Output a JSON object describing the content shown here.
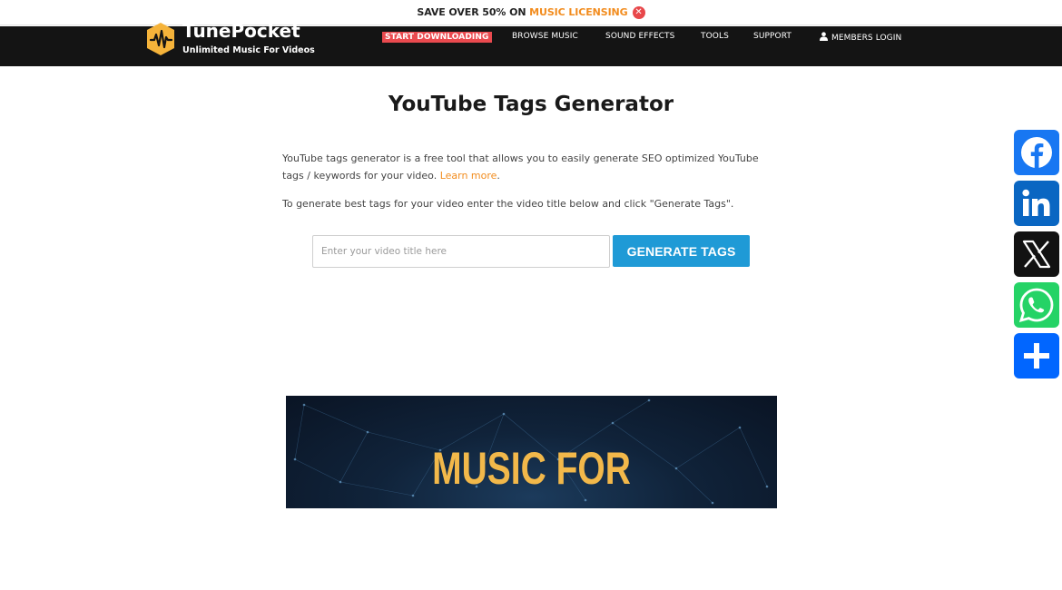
{
  "promo": {
    "prefix": "SAVE OVER 50% ON ",
    "link": "MUSIC LICENSING",
    "close_icon": "close-icon"
  },
  "header": {
    "logo_name": "TunePocket",
    "logo_tagline": "Unlimited Music For Videos",
    "nav": {
      "start": "START DOWNLOADING",
      "browse": "BROWSE MUSIC",
      "sfx": "SOUND EFFECTS",
      "tools": "TOOLS",
      "support": "SUPPORT",
      "login": "MEMBERS LOGIN"
    },
    "colors": {
      "bar": "#141414",
      "start_badge": "#ea4a4f",
      "logo": "#f5b33a"
    }
  },
  "main": {
    "title": "YouTube Tags Generator",
    "intro": "YouTube tags generator is a free tool that allows you to easily generate SEO optimized YouTube tags / keywords for your video. ",
    "learn_more": "Learn more",
    "intro_end": ".",
    "instruction": "To generate best tags for your video enter the video title below and click \"Generate Tags\".",
    "input_placeholder": "Enter your video title here",
    "input_value": "",
    "button": "GENERATE TAGS"
  },
  "banner": {
    "text": "MUSIC FOR"
  },
  "share": {
    "items": [
      {
        "name": "Facebook",
        "icon": "facebook-icon",
        "color": "#1877f2"
      },
      {
        "name": "LinkedIn",
        "icon": "linkedin-icon",
        "color": "#0a66c2"
      },
      {
        "name": "X",
        "icon": "x-icon",
        "color": "#121212"
      },
      {
        "name": "WhatsApp",
        "icon": "whatsapp-icon",
        "color": "#25d366"
      },
      {
        "name": "Share",
        "icon": "share-plus-icon",
        "color": "#0166ff"
      }
    ]
  },
  "accent": {
    "orange": "#f28c1e",
    "blue": "#1f9ad6"
  }
}
